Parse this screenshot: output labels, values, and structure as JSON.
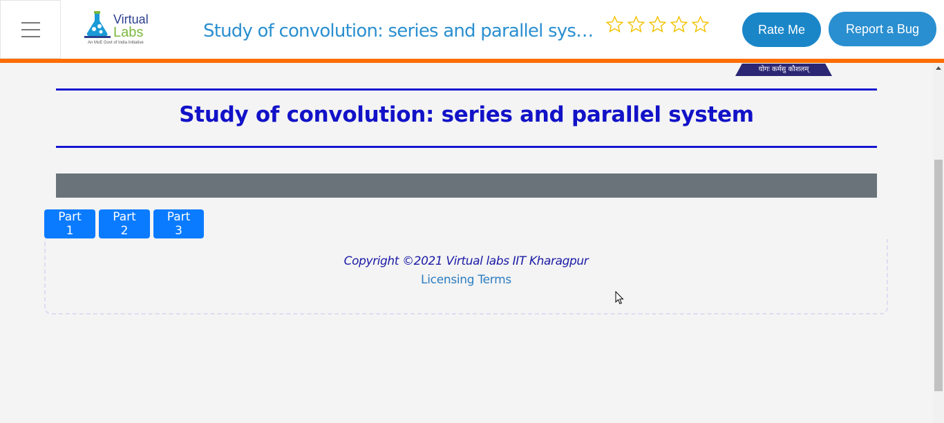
{
  "header": {
    "menu_icon": "hamburger-menu-icon",
    "logo": {
      "line1": "Virtual",
      "line2": "Labs",
      "tagline": "An MoE Govt of India Initiative"
    },
    "title": "Study of convolution: series and parallel syste…",
    "rating": {
      "max": 5,
      "value": 0,
      "star_color": "#f2c200"
    },
    "rate_button": "Rate Me",
    "bug_button": "Report a Bug",
    "accent_color": "#ff6d00"
  },
  "motto": "योगः कर्मसु कौशलम्",
  "main": {
    "title": "Study of convolution: series and parallel system",
    "tabs": [
      {
        "label": "Part 1"
      },
      {
        "label": "Part 2"
      },
      {
        "label": "Part 3"
      }
    ]
  },
  "footer": {
    "copyright": "Copyright ©2021 Virtual labs IIT Kharagpur",
    "license_link": "Licensing Terms"
  }
}
